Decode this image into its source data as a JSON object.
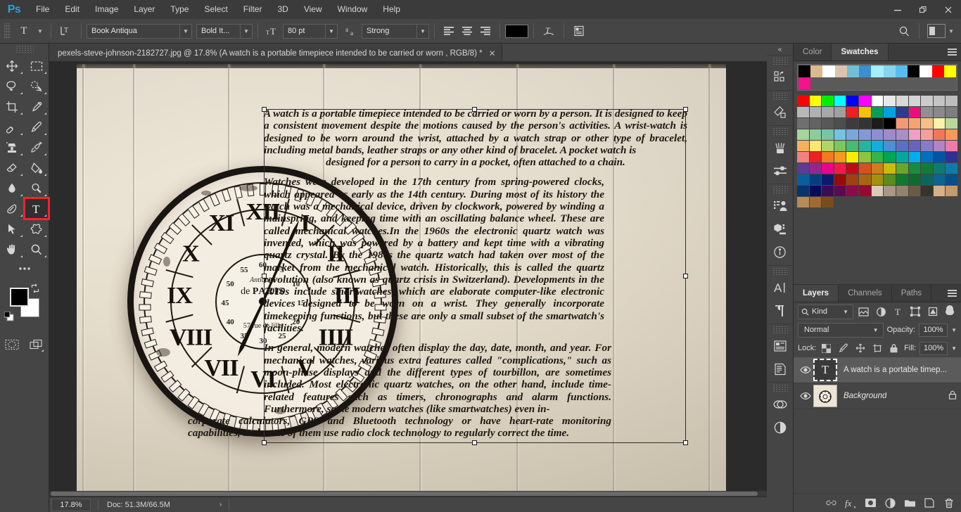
{
  "app": {
    "name": "Photoshop",
    "logo": "Ps"
  },
  "menubar": {
    "items": [
      "File",
      "Edit",
      "Image",
      "Layer",
      "Type",
      "Select",
      "Filter",
      "3D",
      "View",
      "Window",
      "Help"
    ]
  },
  "window_controls": {
    "minimize": "—",
    "restore": "❐",
    "close": "✕"
  },
  "options_bar": {
    "tool_icon": "T",
    "tool_preset_label": "T",
    "orientation_icon": "toggle-text-orientation-icon",
    "font_family": "Book Antiqua",
    "font_style": "Bold It...",
    "size_icon": "font-size-icon",
    "font_size": "80 pt",
    "antialias_icon": "aa",
    "antialias": "Strong",
    "align_left": "align-left-icon",
    "align_center": "align-center-icon",
    "align_right": "align-right-icon",
    "text_color": "#000000",
    "warp_icon": "create-warped-text-icon",
    "panels_icon": "toggle-character-paragraph-panels-icon",
    "search_icon": "search-icon",
    "workspace_icon": "workspace-switcher-icon"
  },
  "document_tab": {
    "title": "pexels-steve-johnson-2182727.jpg @ 17.8%  (A watch is a portable timepiece intended to be carried or worn , RGB/8) *",
    "close": "✕"
  },
  "toolbar": {
    "tools": [
      {
        "name": "move-tool",
        "glyph": "move"
      },
      {
        "name": "rectangular-marquee-tool",
        "glyph": "marquee"
      },
      {
        "name": "lasso-tool",
        "glyph": "lasso"
      },
      {
        "name": "object-selection-tool",
        "glyph": "quickselect"
      },
      {
        "name": "crop-tool",
        "glyph": "crop"
      },
      {
        "name": "eyedropper-tool",
        "glyph": "eyedropper"
      },
      {
        "name": "spot-healing-brush-tool",
        "glyph": "healing"
      },
      {
        "name": "brush-tool",
        "glyph": "brush"
      },
      {
        "name": "clone-stamp-tool",
        "glyph": "stamp"
      },
      {
        "name": "history-brush-tool",
        "glyph": "historybrush"
      },
      {
        "name": "eraser-tool",
        "glyph": "eraser"
      },
      {
        "name": "gradient-tool",
        "glyph": "paintbucket"
      },
      {
        "name": "blur-tool",
        "glyph": "blur"
      },
      {
        "name": "dodge-tool",
        "glyph": "dodge"
      },
      {
        "name": "pen-tool",
        "glyph": "pen"
      },
      {
        "name": "horizontal-type-tool",
        "glyph": "type",
        "active": true
      },
      {
        "name": "path-selection-tool",
        "glyph": "pathselect"
      },
      {
        "name": "custom-shape-tool",
        "glyph": "shape"
      },
      {
        "name": "hand-tool",
        "glyph": "hand"
      },
      {
        "name": "zoom-tool",
        "glyph": "zoom"
      }
    ],
    "edit_toolbar": "•••",
    "foreground_color": "#000000",
    "background_color": "#ffffff",
    "quick_mask": "quick-mask-icon",
    "screen_mode": "screen-mode-icon"
  },
  "canvas": {
    "paragraphs": [
      "A watch is a portable timepiece intended to be carried or worn by a person. It is designed to keep a consistent movement despite the motions caused by the person's activities. A wrist-watch is designed to be worn around the wrist, attached by a watch strap or other type of bracelet, including metal bands, leather straps or any other kind of bracelet. A pocket watch is",
      "designed for a person to carry in a pocket, often attached to a chain.",
      "Watches were developed in the 17th century from spring-powered clocks, which appeared as early as the 14th century. During most of its history the watch was a mechanical device, driven by clockwork, powered by winding a mainspring, and keeping time with an oscillating balance wheel. These are called mechanical watches.In the 1960s the electronic quartz watch was invented, which was powered by a battery and kept time with a vibrating quartz crystal. By the 1980s the quartz watch had taken over most of the market from the mechanical watch. Historically, this is called the quartz revolution (also known as quartz crisis in Switzerland). Developments in the 2010s include smartwatches, which are elaborate computer-like electronic devices designed to be worn on a wrist. They generally incorporate timekeeping functions, but these are only a small subset of the smartwatch's facilities.",
      "In general, modern watches often display the day, date, month, and year. For mechanical watches, various extra features called \"complications,\" such as moon-phase displays and the different types of tourbillon, are sometimes included. Most electronic quartz watches, on the other hand, include time-related features such as timers, chronographs and alarm functions. Furthermore, some modern watches (like smartwatches) even in-",
      "corporate calculators, GPS and Bluetooth technology or have heart-rate monitoring capabilities, and some of them use radio clock technology to regularly correct the time."
    ],
    "clock": {
      "numerals": [
        "XII",
        "I",
        "II",
        "III",
        "IIII",
        "V",
        "VI",
        "VII",
        "VIII",
        "IX",
        "X",
        "XI"
      ],
      "subdial_numbers": [
        "60",
        "5",
        "10",
        "15",
        "20",
        "25",
        "30",
        "35",
        "40",
        "45",
        "50",
        "55"
      ],
      "brand": "Antiquité",
      "city": "de PARIS",
      "address": "57 rue de lille"
    }
  },
  "right_rail": {
    "collapse": "«",
    "groups": [
      [
        "libraries-icon"
      ],
      [
        "adjustments-icon"
      ],
      [
        "brush-settings-icon",
        "brush-presets-icon"
      ],
      [
        "styles-icon",
        "3d-icon",
        "info-icon"
      ],
      [
        "character-icon",
        "paragraph-icon"
      ],
      [
        "character-styles-icon",
        "paragraph-styles-icon"
      ],
      [
        "layer-comps-icon",
        "adjustment-layer-icon"
      ]
    ]
  },
  "color_panel": {
    "tabs": [
      {
        "label": "Color",
        "active": false
      },
      {
        "label": "Swatches",
        "active": true
      }
    ],
    "menu_icon": "panel-menu-icon",
    "recent": [
      "#000000",
      "#ddb98e",
      "#ffffff",
      "#dcc4ac",
      "#6fc0d6",
      "#3b8ed0",
      "#a5eefb",
      "#86d4ef",
      "#57bdee",
      "#000000",
      "#ffffff",
      "#ff0000",
      "#ffff00",
      "#f5128b"
    ],
    "grid": [
      "#ff0000",
      "#ffff00",
      "#00ee00",
      "#00ffff",
      "#0000ff",
      "#ff00ff",
      "#ffffff",
      "#e8e8e8",
      "#d8d8d8",
      "#d4d4d4",
      "#cccccc",
      "#c4c4c4",
      "#bdbdbd",
      "#b8b8b8",
      "#b0b0b0",
      "#a8a8a8",
      "#a0a0a0",
      "#f02020",
      "#f5c400",
      "#00a05a",
      "#00a0e8",
      "#2b3b8f",
      "#ec0e7c",
      "#909090",
      "#8a8a8a",
      "#7e7e7e",
      "#6f6f6f",
      "#636363",
      "#585858",
      "#4e4e4e",
      "#3c3c3c",
      "#343434",
      "#1c1c1c",
      "#000000",
      "#f39a72",
      "#f4a472",
      "#f7bf84",
      "#fbf2a8",
      "#b9d99a",
      "#a5d59d",
      "#8ecb9c",
      "#79c3a6",
      "#74c2e2",
      "#7aa6dd",
      "#8398d9",
      "#8e8fd3",
      "#a289c9",
      "#ad8ccb",
      "#f09ec4",
      "#f69e9e",
      "#f2765c",
      "#f59a57",
      "#f7b05a",
      "#fbe86f",
      "#b0d568",
      "#7ec65c",
      "#46bb74",
      "#23b5a4",
      "#0fb0e0",
      "#4b8fd6",
      "#5a6fc6",
      "#6a63bb",
      "#8a7bc4",
      "#b184c5",
      "#f07aa8",
      "#f2807e",
      "#ed2024",
      "#f37a1f",
      "#f69a1f",
      "#fced00",
      "#8cc63e",
      "#35b44a",
      "#00a551",
      "#00a99d",
      "#00aeef",
      "#0071bc",
      "#0054a6",
      "#2e3192",
      "#5c3a96",
      "#92278f",
      "#ec008c",
      "#ed1c4a",
      "#be0c17",
      "#d4521c",
      "#cf7e1a",
      "#c9bb0c",
      "#6aa62a",
      "#1a8b3a",
      "#137a36",
      "#0e7a72",
      "#0e7ca8",
      "#0b5e9e",
      "#073e7e",
      "#0a1b6e",
      "#9a0a0b",
      "#a34010",
      "#a96611",
      "#a6920a",
      "#5a8c20",
      "#0f7a2c",
      "#0e6b2b",
      "#0d6560",
      "#0b6590",
      "#084f8a",
      "#05356b",
      "#050d5b",
      "#3b0c55",
      "#5a0b50",
      "#8c0a4a",
      "#960a30",
      "#d9cdb6",
      "#a89884",
      "#94826c",
      "#6d5a44",
      "#3a332b",
      "#d8b087",
      "#c79a6e",
      "#b88a55",
      "#a06b2e",
      "#7a4d1c"
    ]
  },
  "layers_panel": {
    "tabs": [
      {
        "label": "Layers",
        "active": true
      },
      {
        "label": "Channels",
        "active": false
      },
      {
        "label": "Paths",
        "active": false
      }
    ],
    "menu_icon": "panel-menu-icon",
    "filter": {
      "search_icon": "search-icon",
      "kind": "Kind",
      "icons": [
        "filter-pixel-icon",
        "filter-adjustment-icon",
        "filter-type-icon",
        "filter-shape-icon",
        "filter-smart-object-icon"
      ],
      "toggle": "filter-toggle-icon"
    },
    "blend_mode": "Normal",
    "opacity_label": "Opacity:",
    "opacity_value": "100%",
    "lock_label": "Lock:",
    "lock_icons": [
      "lock-transparent-pixels-icon",
      "lock-image-pixels-icon",
      "lock-position-icon",
      "lock-artboard-nesting-icon",
      "lock-all-icon"
    ],
    "fill_label": "Fill:",
    "fill_value": "100%",
    "layers": [
      {
        "name": "A watch is a portable timep...",
        "thumb": "T",
        "type": "text",
        "selected": true,
        "visible": true,
        "locked": false
      },
      {
        "name": "Background",
        "thumb": "image",
        "type": "background",
        "selected": false,
        "visible": true,
        "locked": true
      }
    ],
    "footer_icons": [
      "link-layers-icon",
      "layer-style-icon",
      "layer-mask-icon",
      "adjustment-layer-icon",
      "new-group-icon",
      "new-layer-icon",
      "delete-layer-icon"
    ]
  },
  "status_bar": {
    "zoom": "17.8%",
    "doc_info": "Doc: 51.3M/66.5M",
    "arrow": "›"
  }
}
